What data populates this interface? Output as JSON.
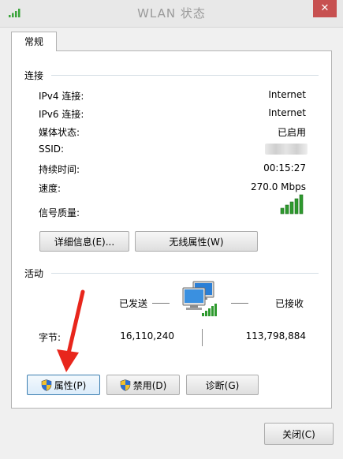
{
  "window": {
    "title": "WLAN 状态",
    "close_label": "✕",
    "app_icon": "wifi-signal-icon",
    "tab_label": "常规"
  },
  "connection": {
    "section_title": "连接",
    "rows": [
      {
        "label": "IPv4 连接:",
        "value": "Internet"
      },
      {
        "label": "IPv6 连接:",
        "value": "Internet"
      },
      {
        "label": "媒体状态:",
        "value": "已启用"
      },
      {
        "label": "SSID:",
        "value": ""
      },
      {
        "label": "持续时间:",
        "value": "00:15:27"
      },
      {
        "label": "速度:",
        "value": "270.0 Mbps"
      },
      {
        "label": "信号质量:",
        "value": ""
      }
    ],
    "signal_icon": "signal-bars-icon",
    "details_button": "详细信息(E)...",
    "wireless_props_button": "无线属性(W)"
  },
  "activity": {
    "section_title": "活动",
    "sent_label": "已发送",
    "received_label": "已接收",
    "bytes_label": "字节:",
    "bytes_sent": "16,110,240",
    "bytes_received": "113,798,884",
    "network_icon": "network-computers-icon"
  },
  "actions": {
    "properties_button": "属性(P)",
    "disable_button": "禁用(D)",
    "diagnose_button": "诊断(G)",
    "shield_icon": "uac-shield-icon"
  },
  "footer": {
    "close_button": "关闭(C)"
  },
  "colors": {
    "accent_arrow": "#e8261c",
    "signal_green": "#2e9a2e",
    "close_red": "#c75050"
  }
}
